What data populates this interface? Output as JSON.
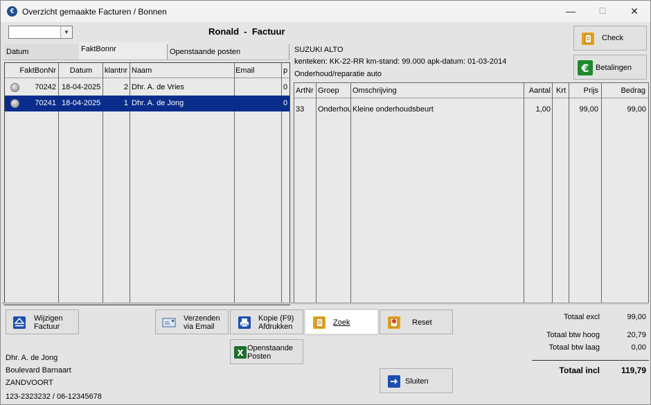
{
  "window": {
    "title": "Overzicht gemaakte Facturen / Bonnen",
    "app_icon": "app-logo-icon",
    "controls": {
      "minimize": "—",
      "maximize": "☐",
      "close": "✕"
    }
  },
  "filter": {
    "selected": ""
  },
  "header": {
    "title": "Ronald  -  Factuur"
  },
  "tabs": {
    "datum": "Datum",
    "faktbonnr": "FaktBonnr",
    "openstaande": "Openstaande posten"
  },
  "invoices": {
    "columns": [
      "FaktBonNr",
      "Datum",
      "klantnr",
      "Naam",
      "Email",
      "p"
    ],
    "rows": [
      {
        "faktbonnr": "70242",
        "datum": "18-04-2025",
        "klantnr": "2",
        "naam": "Dhr. A. de Vries",
        "email": "",
        "p": "0",
        "selected": false
      },
      {
        "faktbonnr": "70241",
        "datum": "18-04-2025",
        "klantnr": "1",
        "naam": "Dhr. A. de Jong",
        "email": "",
        "p": "0",
        "selected": true
      }
    ]
  },
  "vehicle": {
    "model": "SUZUKI ALTO",
    "details": "kenteken: KK-22-RR  km-stand: 99.000  apk-datum: 01-03-2014",
    "description": "Onderhoud/reparatie auto"
  },
  "lines": {
    "columns": [
      "ArtNr",
      "Groep",
      "Omschrijving",
      "Aantal",
      "Krt",
      "Prijs",
      "Bedrag"
    ],
    "rows": [
      {
        "artnr": "33",
        "groep": "Onderhoud",
        "omschrijving": "Kleine onderhoudsbeurt",
        "aantal": "1,00",
        "krt": "",
        "prijs": "99,00",
        "bedrag": "99,00"
      }
    ]
  },
  "buttons": {
    "check": "Check",
    "betalingen": "Betalingen",
    "wijzigen_1": "Wijzigen",
    "wijzigen_2": "Factuur",
    "verzenden_1": "Verzenden",
    "verzenden_2": "via Email",
    "kopie_1": "Kopie (F9)",
    "kopie_2": "Afdrukken",
    "zoek": "Zoek",
    "reset": "Reset",
    "openstaande_1": "Openstaande",
    "openstaande_2": "Posten",
    "sluiten": "Sluiten"
  },
  "customer": {
    "name": "Dhr. A. de Jong",
    "street": "Boulevard Barnaart",
    "city": "ZANDVOORT",
    "phone": "123-2323232 / 06-12345678"
  },
  "totals": {
    "excl_label": "Totaal excl",
    "excl": "99,00",
    "btw_hoog_label": "Totaal btw hoog",
    "btw_hoog": "20,79",
    "btw_laag_label": "Totaal btw laag",
    "btw_laag": "0,00",
    "incl_label": "Totaal incl",
    "incl": "119,79"
  },
  "colors": {
    "selection": "#0a2d8c",
    "accent_blue": "#1c4fb0",
    "euro_green": "#1e8a2e",
    "icon_orange": "#e6a21c"
  }
}
